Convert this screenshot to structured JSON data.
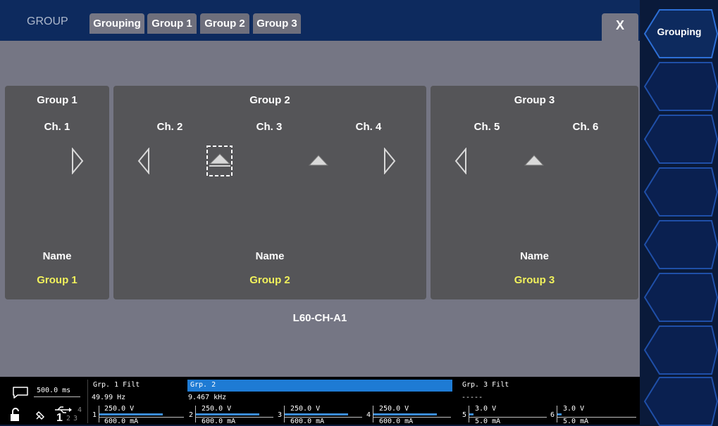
{
  "header": {
    "title": "GROUP",
    "tabs": [
      {
        "label": "Grouping",
        "active": true
      },
      {
        "label": "Group 1",
        "active": false
      },
      {
        "label": "Group 2",
        "active": false
      },
      {
        "label": "Group 3",
        "active": false
      }
    ],
    "close_label": "X"
  },
  "groups": [
    {
      "title": "Group 1",
      "channels": [
        "Ch. 1"
      ],
      "name_label": "Name",
      "name_value": "Group 1"
    },
    {
      "title": "Group 2",
      "channels": [
        "Ch. 2",
        "Ch. 3",
        "Ch. 4"
      ],
      "name_label": "Name",
      "name_value": "Group 2"
    },
    {
      "title": "Group 3",
      "channels": [
        "Ch. 5",
        "Ch. 6"
      ],
      "name_label": "Name",
      "name_value": "Group 3"
    }
  ],
  "device_label": "L60-CH-A1",
  "sidebar": {
    "buttons": [
      {
        "label": "Grouping"
      },
      {
        "label": ""
      },
      {
        "label": ""
      },
      {
        "label": ""
      },
      {
        "label": ""
      },
      {
        "label": ""
      },
      {
        "label": ""
      },
      {
        "label": ""
      }
    ]
  },
  "status": {
    "cycle_time": "500.0 ms",
    "groups": [
      {
        "label": "Grp. 1",
        "filter": "Filt",
        "frequency": "49.99  Hz",
        "channels": [
          {
            "num": "1",
            "voltage": "250.0 V",
            "current": "600.0 mA"
          }
        ]
      },
      {
        "label": "Grp. 2",
        "filter": "",
        "frequency": "9.467 kHz",
        "channels": [
          {
            "num": "2",
            "voltage": "250.0 V",
            "current": "600.0 mA"
          },
          {
            "num": "3",
            "voltage": "250.0 V",
            "current": "600.0 mA"
          },
          {
            "num": "4",
            "voltage": "250.0 V",
            "current": "600.0 mA"
          }
        ]
      },
      {
        "label": "Grp. 3",
        "filter": "Filt",
        "frequency": "-----",
        "channels": [
          {
            "num": "5",
            "voltage": "3.0 V",
            "current": "5.0 mA"
          },
          {
            "num": "6",
            "voltage": "3.0 V",
            "current": "5.0 mA"
          }
        ]
      }
    ],
    "icons": [
      "message-icon",
      "lock-icon",
      "plug-icon",
      "usb-icon",
      "channel-indicator"
    ],
    "indicator_digits": [
      "4",
      "1",
      "2",
      "3"
    ]
  }
}
